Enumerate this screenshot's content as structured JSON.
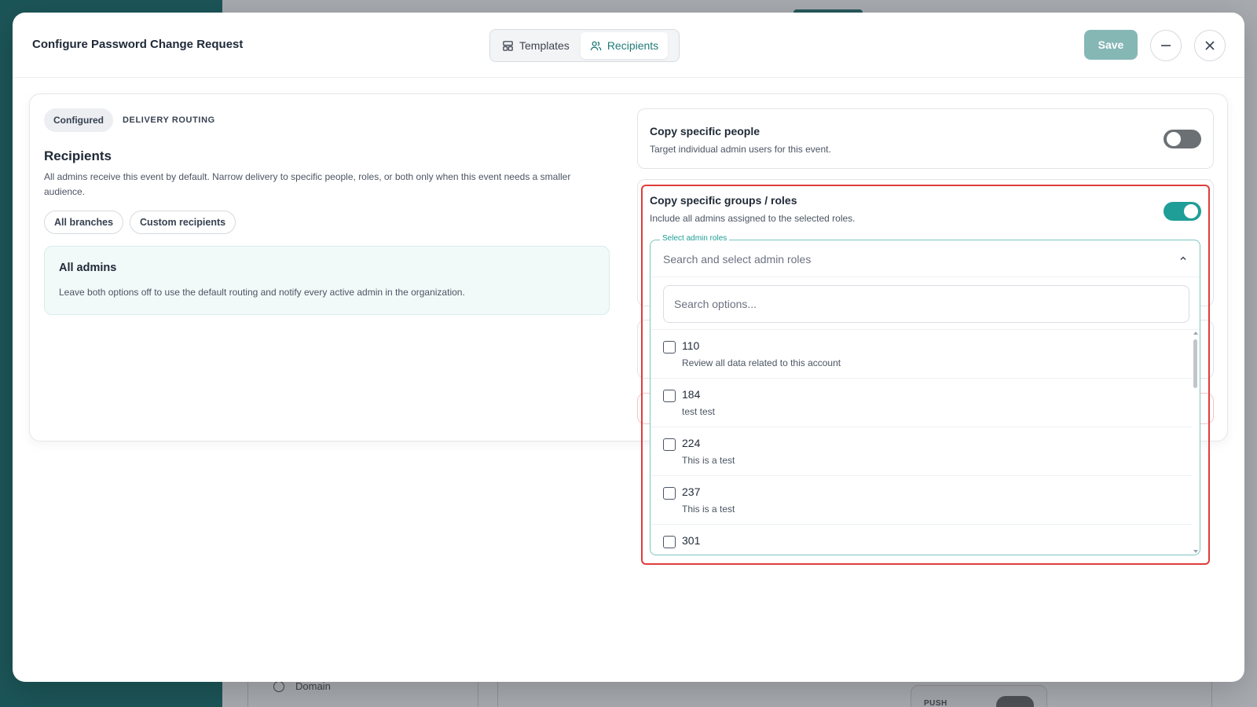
{
  "background": {
    "nav_item_label": "Domain",
    "card_label": "PUSH"
  },
  "modal": {
    "title": "Configure Password Change Request",
    "tabs": [
      {
        "label": "Templates",
        "icon": "template-icon",
        "active": false
      },
      {
        "label": "Recipients",
        "icon": "users-icon",
        "active": true
      }
    ],
    "save_label": "Save",
    "minimize_icon": "minus-icon",
    "close_icon": "close-icon"
  },
  "left": {
    "chip_configured": "Configured",
    "chip_routing": "DELIVERY ROUTING",
    "title": "Recipients",
    "description": "All admins receive this event by default. Narrow delivery to specific people, roles, or both only when this event needs a smaller audience.",
    "pills": [
      "All branches",
      "Custom recipients"
    ],
    "all_admins": {
      "title": "All admins",
      "description": "Leave both options off to use the default routing and notify every active admin in the organization."
    }
  },
  "right": {
    "copy_people": {
      "title": "Copy specific people",
      "description": "Target individual admin users for this event.",
      "enabled": false
    },
    "copy_groups": {
      "title": "Copy specific groups / roles",
      "description": "Include all admins assigned to the selected roles.",
      "enabled": true,
      "select_label": "Select admin roles",
      "select_placeholder": "Search and select admin roles",
      "search_placeholder": "Search options...",
      "options": [
        {
          "code": "110",
          "description": "Review all data related to this account",
          "checked": false
        },
        {
          "code": "184",
          "description": "test test",
          "checked": false
        },
        {
          "code": "224",
          "description": "This is a test",
          "checked": false
        },
        {
          "code": "237",
          "description": "This is a test",
          "checked": false
        },
        {
          "code": "301",
          "description": "",
          "checked": false
        }
      ]
    }
  },
  "colors": {
    "accent": "#1e9e97",
    "save_button": "#85b7b5",
    "highlight_border": "#e03c3c",
    "sidebar": "#1c5558"
  }
}
